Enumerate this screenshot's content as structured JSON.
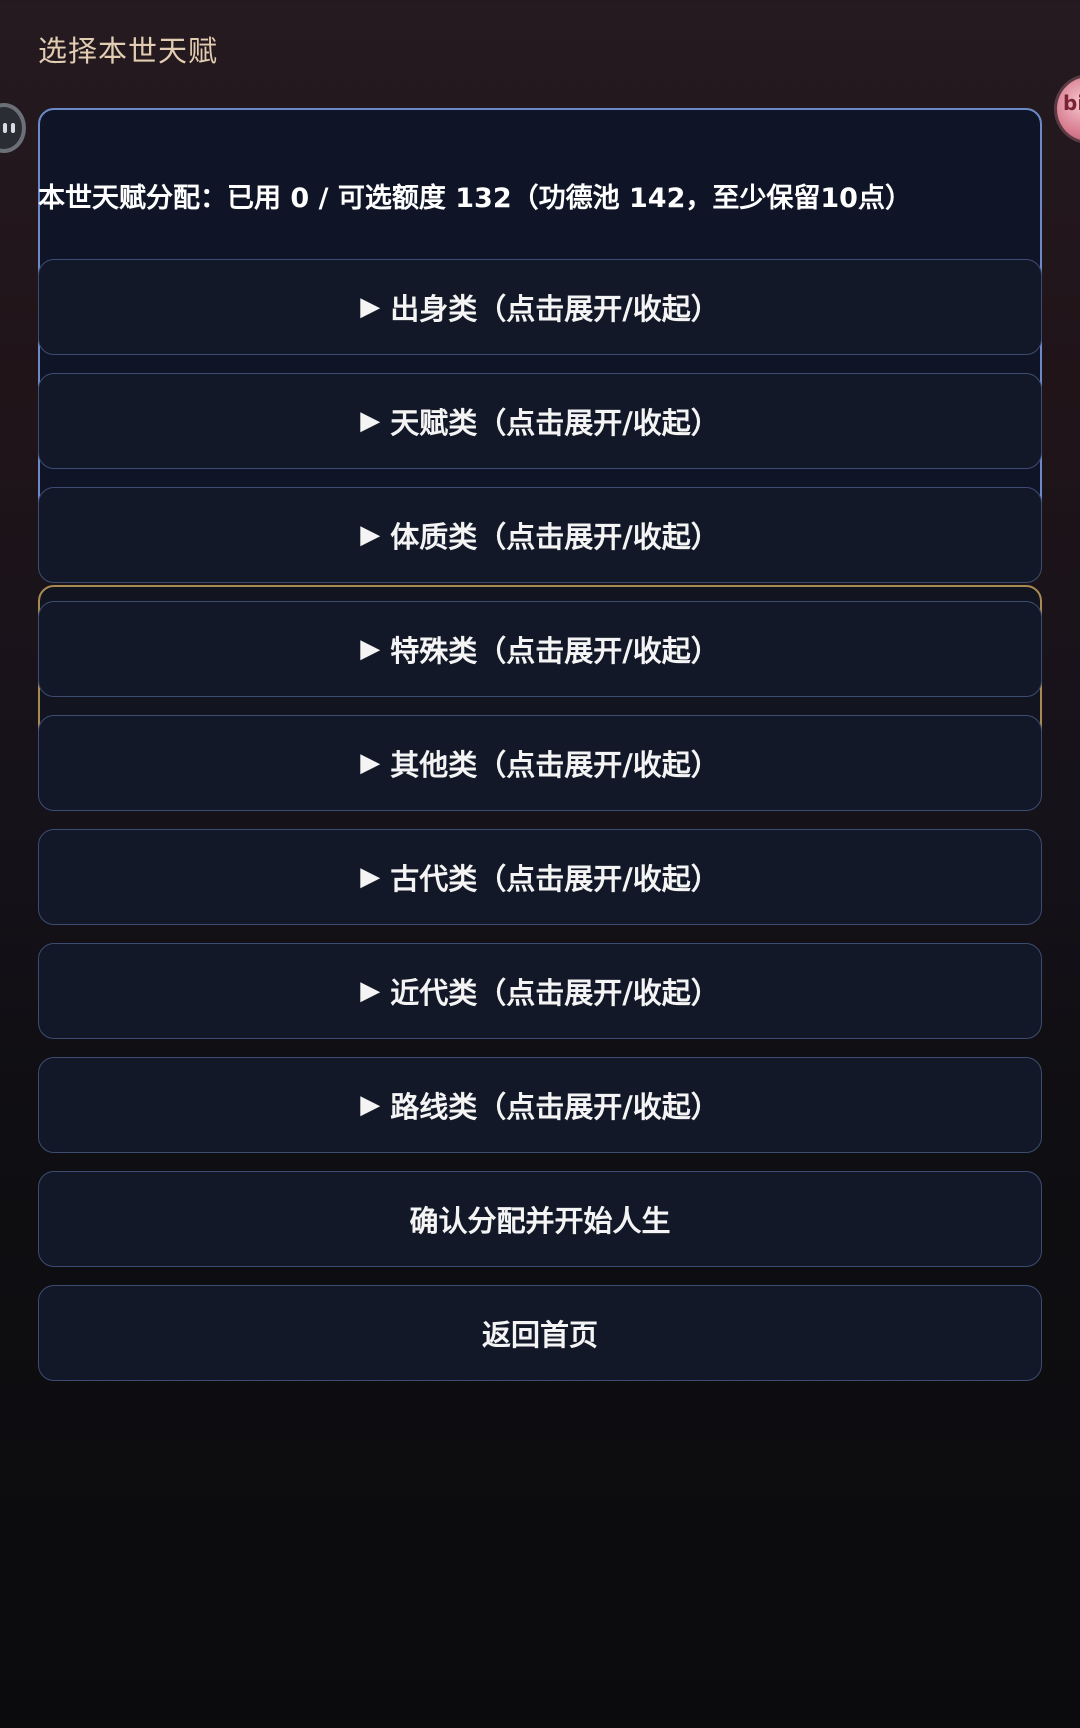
{
  "header": {
    "title": "选择本世天赋"
  },
  "overlay": {
    "left_button_icon": "pause-icon",
    "right_avatar_icon": "avatar-icon",
    "right_avatar_text": "bi"
  },
  "allocation": {
    "summary": "本世天赋分配：已用 0 / 可选额度 132（功德池 142，至少保留10点）",
    "used": 0,
    "available": 132,
    "merit_pool": 142,
    "min_reserve": 10
  },
  "categories": [
    {
      "arrow": "▶",
      "label": "出身类",
      "hint": "（点击展开/收起）"
    },
    {
      "arrow": "▶",
      "label": "天赋类",
      "hint": "（点击展开/收起）"
    },
    {
      "arrow": "▶",
      "label": "体质类",
      "hint": "（点击展开/收起）"
    },
    {
      "arrow": "▶",
      "label": "特殊类",
      "hint": "（点击展开/收起）"
    },
    {
      "arrow": "▶",
      "label": "其他类",
      "hint": "（点击展开/收起）"
    },
    {
      "arrow": "▶",
      "label": "古代类",
      "hint": "（点击展开/收起）"
    },
    {
      "arrow": "▶",
      "label": "近代类",
      "hint": "（点击展开/收起）"
    },
    {
      "arrow": "▶",
      "label": "路线类",
      "hint": "（点击展开/收起）"
    }
  ],
  "actions": {
    "confirm_label": "确认分配并开始人生",
    "back_label": "返回首页"
  }
}
